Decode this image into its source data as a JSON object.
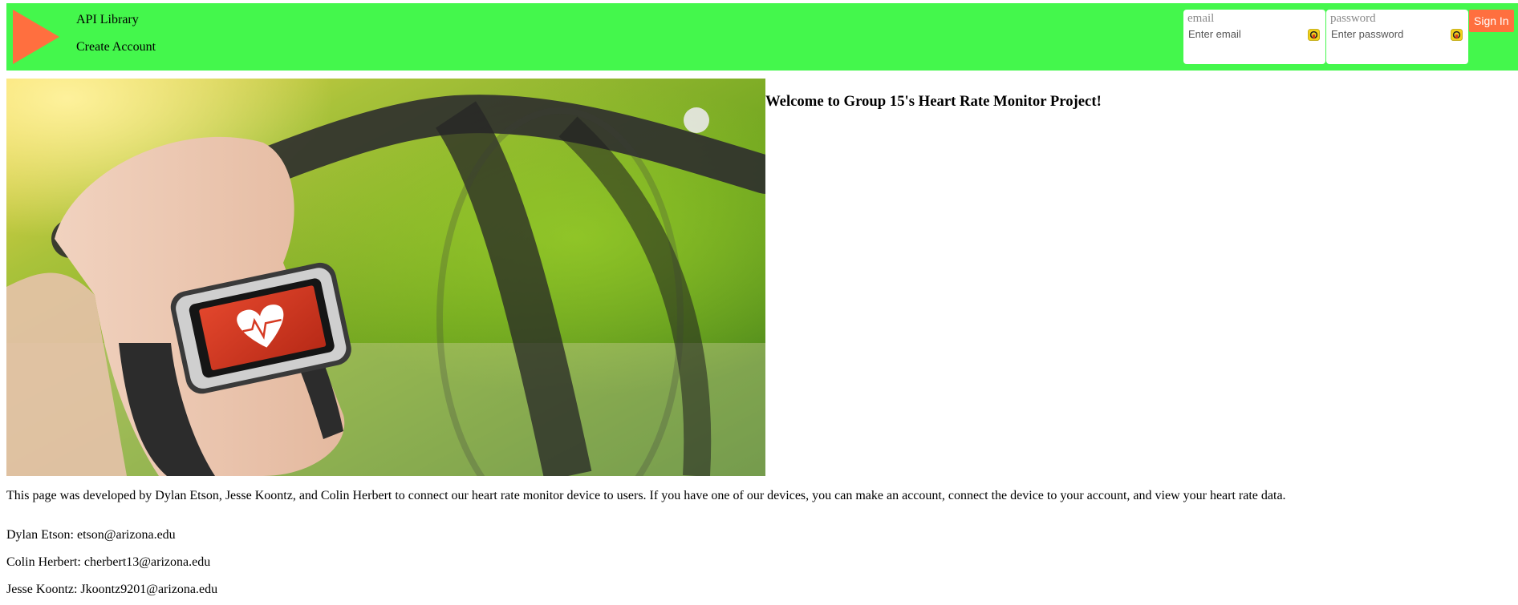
{
  "nav": {
    "links": [
      "API Library",
      "Create Account"
    ],
    "logo_color": "#ff6f3f",
    "bar_color": "#44f74c"
  },
  "login": {
    "email_label": "email",
    "email_placeholder": "Enter email",
    "password_label": "password",
    "password_placeholder": "Enter password",
    "signin_label": "Sign In",
    "signin_color": "#ff6f3f"
  },
  "hero": {
    "heading": "Welcome to Group 15's Heart Rate Monitor Project!"
  },
  "content": {
    "description": "This page was developed by Dylan Etson, Jesse Koontz, and Colin Herbert to connect our heart rate monitor device to users. If you have one of our devices, you can make an account, connect the device to your account, and view your heart rate data.",
    "contacts": [
      "Dylan Etson: etson@arizona.edu",
      "Colin Herbert: cherbert13@arizona.edu",
      "Jesse Koontz: Jkoontz9201@arizona.edu"
    ]
  }
}
